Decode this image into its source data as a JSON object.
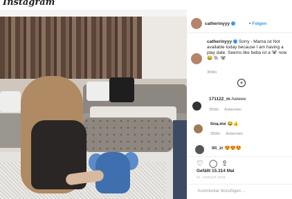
{
  "app": {
    "logo": "Instagram"
  },
  "post": {
    "username": "catherinyyy",
    "follow_label": "Folgen",
    "caption_user": "catherinyyy",
    "caption_text": "Sorry - Mama ist Not available today because I am having a play date. Seems like beba ist a 🐨 now 😂 🐘 🐨",
    "caption_time": "35Wo",
    "load_more": "+",
    "comments": [
      {
        "user": "171122_m",
        "text": "Awieee",
        "time": "35Wo",
        "reply": "Antworten"
      },
      {
        "user": "tina.mx",
        "text": "😂👍",
        "time": "35Wo",
        "reply": "Antworten"
      },
      {
        "user": "lili_zr",
        "text": "😍😍😍",
        "time": "",
        "reply": ""
      }
    ],
    "likes_text": "Gefällt 15.314 Mal",
    "date_text": "31. AUGUST 2018",
    "comment_placeholder": "Kommentar hinzufügen ..."
  },
  "icons": [
    "heart-icon",
    "comment-icon",
    "share-icon",
    "bookmark-icon",
    "more-options-icon",
    "verified-badge-icon",
    "plus-circle-icon"
  ],
  "colors": {
    "accent": "#3897f0",
    "text": "#262626",
    "muted": "#8e8e8e"
  }
}
